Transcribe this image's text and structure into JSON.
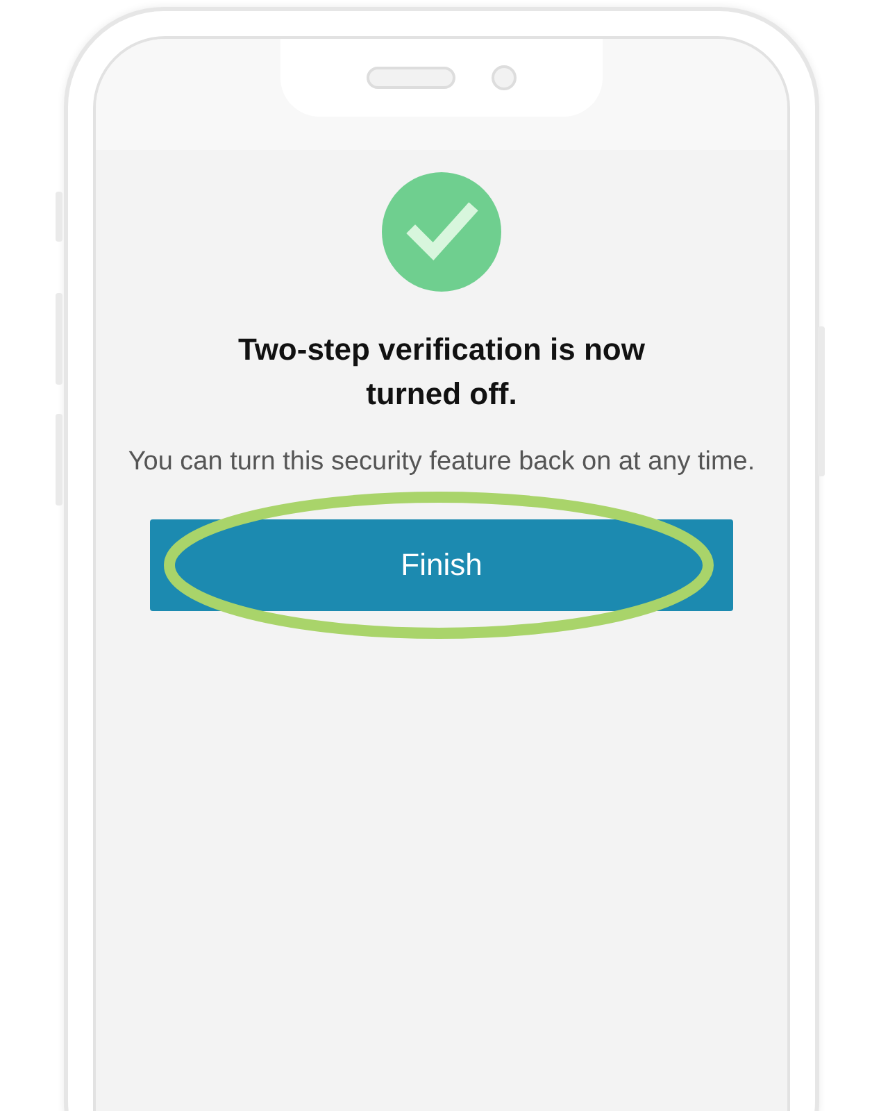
{
  "screen": {
    "title": "Two-step verification is now turned off.",
    "message": "You can turn this security feature back on at any time.",
    "button": {
      "label": "Finish",
      "highlighted": true
    }
  }
}
